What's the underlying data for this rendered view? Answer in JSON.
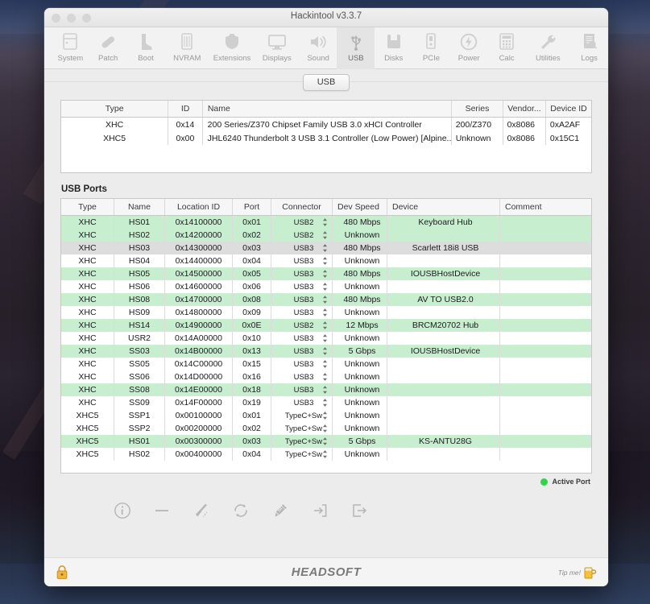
{
  "window": {
    "title": "Hackintool v3.3.7"
  },
  "toolbar": {
    "items": [
      {
        "label": "System",
        "icon": "display-icon",
        "selected": false
      },
      {
        "label": "Patch",
        "icon": "bandage-icon",
        "selected": false
      },
      {
        "label": "Boot",
        "icon": "boot-icon",
        "selected": false
      },
      {
        "label": "NVRAM",
        "icon": "memory-icon",
        "selected": false
      },
      {
        "label": "Extensions",
        "icon": "kext-icon",
        "selected": false
      },
      {
        "label": "Displays",
        "icon": "monitor-icon",
        "selected": false
      },
      {
        "label": "Sound",
        "icon": "speaker-icon",
        "selected": false
      },
      {
        "label": "USB",
        "icon": "usb-icon",
        "selected": true
      },
      {
        "label": "Disks",
        "icon": "disk-icon",
        "selected": false
      },
      {
        "label": "PCIe",
        "icon": "pcie-icon",
        "selected": false
      },
      {
        "label": "Power",
        "icon": "power-bolt-icon",
        "selected": false
      },
      {
        "label": "Calc",
        "icon": "calculator-icon",
        "selected": false
      },
      {
        "label": "Utilities",
        "icon": "wrench-icon",
        "selected": false
      },
      {
        "label": "Logs",
        "icon": "logs-icon",
        "selected": false
      }
    ]
  },
  "tabs": [
    {
      "label": "USB",
      "selected": true
    }
  ],
  "controllers": {
    "headers": [
      "Type",
      "ID",
      "Name",
      "Series",
      "Vendor...",
      "Device ID"
    ],
    "rows": [
      {
        "type": "XHC",
        "id": "0x14",
        "name": "200 Series/Z370 Chipset Family USB 3.0 xHCI Controller",
        "series": "200/Z370",
        "vendor": "0x8086",
        "device_id": "0xA2AF"
      },
      {
        "type": "XHC5",
        "id": "0x00",
        "name": "JHL6240 Thunderbolt 3 USB 3.1 Controller (Low Power) [Alpine...",
        "series": "Unknown",
        "vendor": "0x8086",
        "device_id": "0x15C1"
      }
    ]
  },
  "ports_section": {
    "title": "USB Ports",
    "headers": [
      "Type",
      "Name",
      "Location ID",
      "Port",
      "Connector",
      "Dev Speed",
      "Device",
      "Comment"
    ],
    "rows": [
      {
        "type": "XHC",
        "name": "HS01",
        "location": "0x14100000",
        "port": "0x01",
        "connector": "USB2",
        "speed": "480 Mbps",
        "device": "Keyboard Hub",
        "comment": "",
        "state": "green"
      },
      {
        "type": "XHC",
        "name": "HS02",
        "location": "0x14200000",
        "port": "0x02",
        "connector": "USB2",
        "speed": "Unknown",
        "device": "",
        "comment": "",
        "state": "green"
      },
      {
        "type": "XHC",
        "name": "HS03",
        "location": "0x14300000",
        "port": "0x03",
        "connector": "USB3",
        "speed": "480 Mbps",
        "device": "Scarlett 18i8 USB",
        "comment": "",
        "state": "sel"
      },
      {
        "type": "XHC",
        "name": "HS04",
        "location": "0x14400000",
        "port": "0x04",
        "connector": "USB3",
        "speed": "Unknown",
        "device": "",
        "comment": "",
        "state": "plain"
      },
      {
        "type": "XHC",
        "name": "HS05",
        "location": "0x14500000",
        "port": "0x05",
        "connector": "USB3",
        "speed": "480 Mbps",
        "device": "IOUSBHostDevice",
        "comment": "",
        "state": "green"
      },
      {
        "type": "XHC",
        "name": "HS06",
        "location": "0x14600000",
        "port": "0x06",
        "connector": "USB3",
        "speed": "Unknown",
        "device": "",
        "comment": "",
        "state": "plain"
      },
      {
        "type": "XHC",
        "name": "HS08",
        "location": "0x14700000",
        "port": "0x08",
        "connector": "USB3",
        "speed": "480 Mbps",
        "device": "AV TO USB2.0",
        "comment": "",
        "state": "green"
      },
      {
        "type": "XHC",
        "name": "HS09",
        "location": "0x14800000",
        "port": "0x09",
        "connector": "USB3",
        "speed": "Unknown",
        "device": "",
        "comment": "",
        "state": "plain"
      },
      {
        "type": "XHC",
        "name": "HS14",
        "location": "0x14900000",
        "port": "0x0E",
        "connector": "USB2",
        "speed": "12 Mbps",
        "device": "BRCM20702 Hub",
        "comment": "",
        "state": "green"
      },
      {
        "type": "XHC",
        "name": "USR2",
        "location": "0x14A00000",
        "port": "0x10",
        "connector": "USB3",
        "speed": "Unknown",
        "device": "",
        "comment": "",
        "state": "plain"
      },
      {
        "type": "XHC",
        "name": "SS03",
        "location": "0x14B00000",
        "port": "0x13",
        "connector": "USB3",
        "speed": "5 Gbps",
        "device": "IOUSBHostDevice",
        "comment": "",
        "state": "green"
      },
      {
        "type": "XHC",
        "name": "SS05",
        "location": "0x14C00000",
        "port": "0x15",
        "connector": "USB3",
        "speed": "Unknown",
        "device": "",
        "comment": "",
        "state": "plain"
      },
      {
        "type": "XHC",
        "name": "SS06",
        "location": "0x14D00000",
        "port": "0x16",
        "connector": "USB3",
        "speed": "Unknown",
        "device": "",
        "comment": "",
        "state": "plain"
      },
      {
        "type": "XHC",
        "name": "SS08",
        "location": "0x14E00000",
        "port": "0x18",
        "connector": "USB3",
        "speed": "Unknown",
        "device": "",
        "comment": "",
        "state": "green"
      },
      {
        "type": "XHC",
        "name": "SS09",
        "location": "0x14F00000",
        "port": "0x19",
        "connector": "USB3",
        "speed": "Unknown",
        "device": "",
        "comment": "",
        "state": "plain"
      },
      {
        "type": "XHC5",
        "name": "SSP1",
        "location": "0x00100000",
        "port": "0x01",
        "connector": "TypeC+Sw",
        "speed": "Unknown",
        "device": "",
        "comment": "",
        "state": "plain"
      },
      {
        "type": "XHC5",
        "name": "SSP2",
        "location": "0x00200000",
        "port": "0x02",
        "connector": "TypeC+Sw",
        "speed": "Unknown",
        "device": "",
        "comment": "",
        "state": "plain"
      },
      {
        "type": "XHC5",
        "name": "HS01",
        "location": "0x00300000",
        "port": "0x03",
        "connector": "TypeC+Sw",
        "speed": "5 Gbps",
        "device": "KS-ANTU28G",
        "comment": "",
        "state": "green"
      },
      {
        "type": "XHC5",
        "name": "HS02",
        "location": "0x00400000",
        "port": "0x04",
        "connector": "TypeC+Sw",
        "speed": "Unknown",
        "device": "",
        "comment": "",
        "state": "plain"
      }
    ]
  },
  "legend": {
    "label": "Active Port",
    "color": "#2fd44b"
  },
  "actions": [
    {
      "name": "info-icon"
    },
    {
      "name": "minus-icon"
    },
    {
      "name": "broom-icon"
    },
    {
      "name": "refresh-icon"
    },
    {
      "name": "syringe-icon"
    },
    {
      "name": "import-icon"
    },
    {
      "name": "export-icon"
    }
  ],
  "footer": {
    "lock_icon": "lock-icon",
    "logo": "HEADSOFT",
    "tip_label": "Tip me!",
    "tip_icon": "beer-mug-icon"
  }
}
